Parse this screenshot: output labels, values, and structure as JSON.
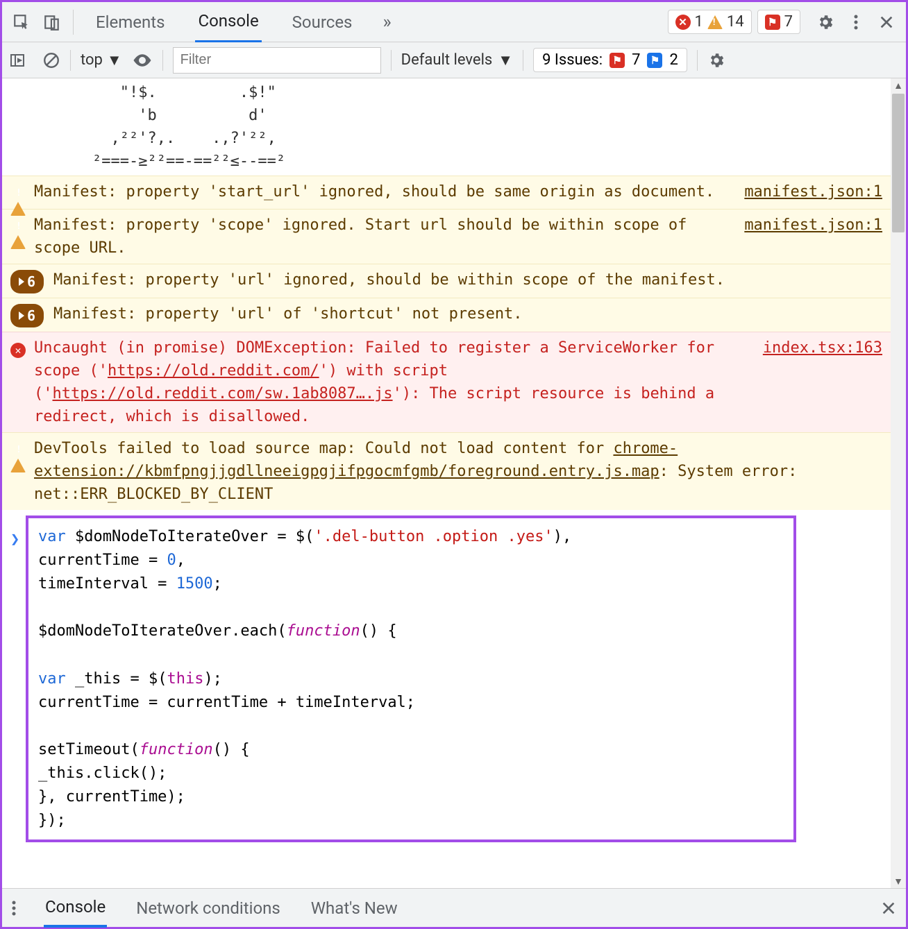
{
  "topbar": {
    "tabs": [
      "Elements",
      "Console",
      "Sources"
    ],
    "active_tab": "Console",
    "errors_count": "1",
    "warnings_count": "14",
    "user_msgs_count": "7"
  },
  "toolbar": {
    "context": "top",
    "filter_placeholder": "Filter",
    "levels_label": "Default levels",
    "issues_label": "9 Issues:",
    "issues_err": "7",
    "issues_info": "2"
  },
  "ascii": "   \"!$.         .$!\"\n     'b          d'\n  ,²²'?,.    .,?'²²,\n²===-≥²²==-==²²≤--==²",
  "rows": [
    {
      "type": "warn",
      "text": "Manifest: property 'start_url' ignored, should be same origin as document.",
      "src": "manifest.json:1"
    },
    {
      "type": "warn",
      "text": "Manifest: property 'scope' ignored. Start url should be within scope of scope URL.",
      "src": "manifest.json:1"
    },
    {
      "type": "warn",
      "pill": "6",
      "text": "Manifest: property 'url' ignored, should be within scope of the manifest."
    },
    {
      "type": "warn",
      "pill": "6",
      "text": "Manifest: property 'url' of 'shortcut' not present."
    },
    {
      "type": "err",
      "pre": "Uncaught (in promise) DOMException: Failed to register a ServiceWorker for scope ('",
      "link1": "https://old.reddit.com/",
      "mid": "') with script ('",
      "link2": "https://old.reddit.com/sw.1ab8087….js",
      "post": "'): The script resource is behind a redirect, which is disallowed.",
      "src": "index.tsx:163"
    },
    {
      "type": "warn",
      "pre": "DevTools failed to load source map: Could not load content for ",
      "link1": "chrome-extension://kbmfpngjjgdllneeigpgjifpgocmfgmb/foreground.entry.js.map",
      "post": ": System error: net::ERR_BLOCKED_BY_CLIENT"
    }
  ],
  "code": {
    "line1_a": "var",
    "line1_b": " $domNodeToIterateOver = $(",
    "line1_c": "'.del-button .option .yes'",
    "line1_d": "),",
    "line2_a": "    currentTime = ",
    "line2_b": "0",
    "line2_c": ",",
    "line3_a": "    timeInterval = ",
    "line3_b": "1500",
    "line3_c": ";",
    "line5": "$domNodeToIterateOver.each(",
    "line5_fun": "function",
    "line5_end": "() {",
    "line7_a": "  var",
    "line7_b": " _this = $(",
    "line7_c": "this",
    "line7_d": ");",
    "line8": "  currentTime = currentTime + timeInterval;",
    "line10_a": "  setTimeout(",
    "line10_fun": "function",
    "line10_b": "() {",
    "line11": "    _this.click();",
    "line12": "  }, currentTime);",
    "line13": "});"
  },
  "drawer": {
    "tabs": [
      "Console",
      "Network conditions",
      "What's New"
    ],
    "active": "Console"
  }
}
